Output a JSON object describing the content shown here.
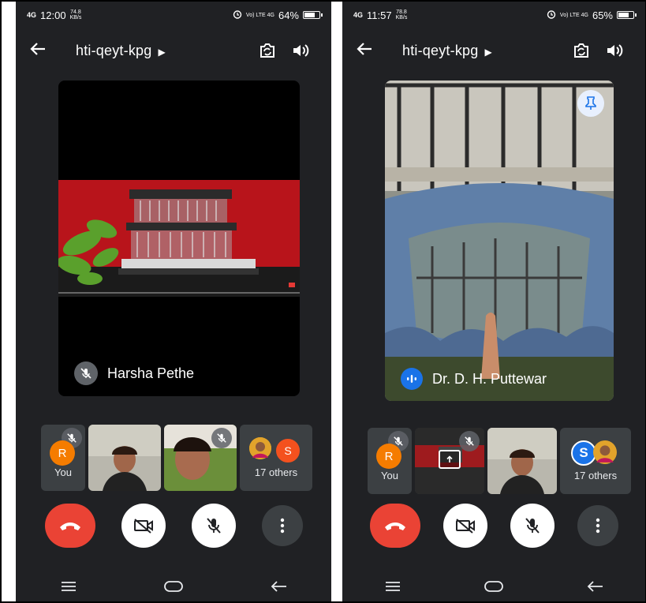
{
  "left": {
    "status": {
      "signal": "4G",
      "time": "12:00",
      "speed": "74.8",
      "speed_unit": "KB/s",
      "network": "Vo) LTE 4G",
      "battery": "64%",
      "battery_level": 0.64
    },
    "meeting_code": "hti-qeyt-kpg",
    "main_speaker": "Harsha Pethe",
    "self_label": "You",
    "self_avatar": "R",
    "others_label": "17 others",
    "others_avatar": "S"
  },
  "right": {
    "status": {
      "signal": "4G",
      "time": "11:57",
      "speed": "78.8",
      "speed_unit": "KB/s",
      "network": "Vo) LTE 4G",
      "battery": "65%",
      "battery_level": 0.65
    },
    "meeting_code": "hti-qeyt-kpg",
    "main_speaker": "Dr. D. H. Puttewar",
    "self_label": "You",
    "self_avatar": "R",
    "others_label": "17 others",
    "others_avatar": "S"
  },
  "icons": {
    "back": "back-arrow-icon",
    "switch_camera": "switch-camera-icon",
    "speaker": "speaker-icon",
    "pin": "pin-icon",
    "mic_off": "mic-off-icon",
    "end_call": "end-call-icon",
    "camera_off": "camera-off-icon",
    "more": "more-vertical-icon"
  },
  "colors": {
    "background": "#202124",
    "end_call": "#ea4335",
    "accent_blue": "#1a73e8",
    "avatar_orange": "#f57c00"
  }
}
